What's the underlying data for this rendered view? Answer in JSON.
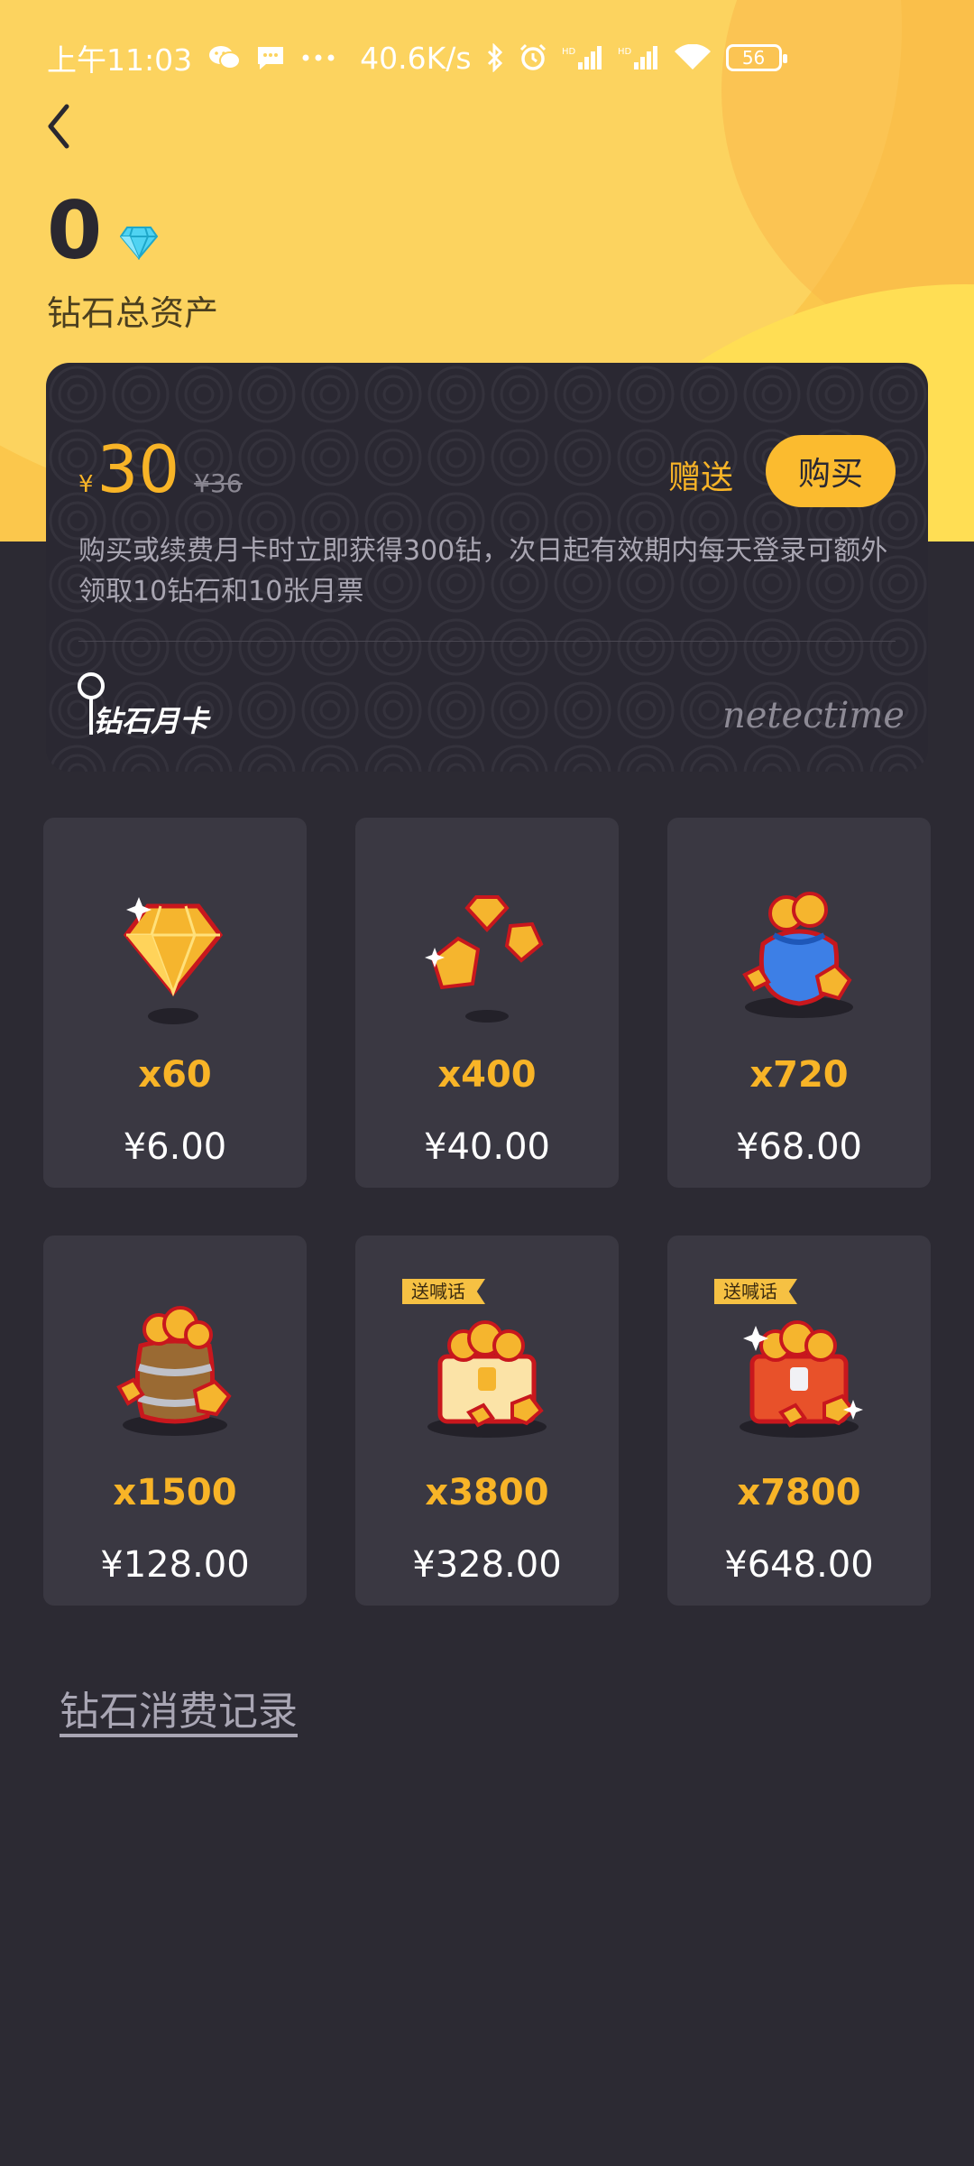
{
  "status_bar": {
    "time": "上午11:03",
    "network_speed": "40.6K/s",
    "battery": "56",
    "icons": [
      "wechat-icon",
      "message-icon",
      "more-dots-icon",
      "bluetooth-icon",
      "alarm-icon",
      "hd-signal-icon",
      "hd-signal-icon",
      "wifi-icon",
      "battery-icon"
    ]
  },
  "header": {
    "back_icon": "chevron-left-icon",
    "balance": "0",
    "balance_icon": "diamond-icon",
    "balance_label": "钻石总资产"
  },
  "monthly_card": {
    "currency": "¥",
    "price": "30",
    "original_price": "¥36",
    "gift_label": "赠送",
    "buy_label": "购买",
    "description": "购买或续费月卡时立即获得300钻，次日起有效期内每天登录可额外领取10钻石和10张月票",
    "logo_text": "钻石月卡",
    "signature_text": "netectime"
  },
  "packages": [
    {
      "quantity": "x60",
      "price": "¥6.00",
      "art": "single-gem-icon",
      "tag": ""
    },
    {
      "quantity": "x400",
      "price": "¥40.00",
      "art": "gem-cluster-icon",
      "tag": ""
    },
    {
      "quantity": "x720",
      "price": "¥68.00",
      "art": "gem-bag-icon",
      "tag": ""
    },
    {
      "quantity": "x1500",
      "price": "¥128.00",
      "art": "gem-barrel-icon",
      "tag": ""
    },
    {
      "quantity": "x3800",
      "price": "¥328.00",
      "art": "gem-chest-icon",
      "tag": "送喊话"
    },
    {
      "quantity": "x7800",
      "price": "¥648.00",
      "art": "gem-red-chest-icon",
      "tag": "送喊话"
    }
  ],
  "footer": {
    "record_link": "钻石消费记录"
  },
  "colors": {
    "accent": "#f8b427",
    "background": "#2c2a33",
    "card": "#3a3842",
    "header_yellow": "#fcd35f"
  }
}
